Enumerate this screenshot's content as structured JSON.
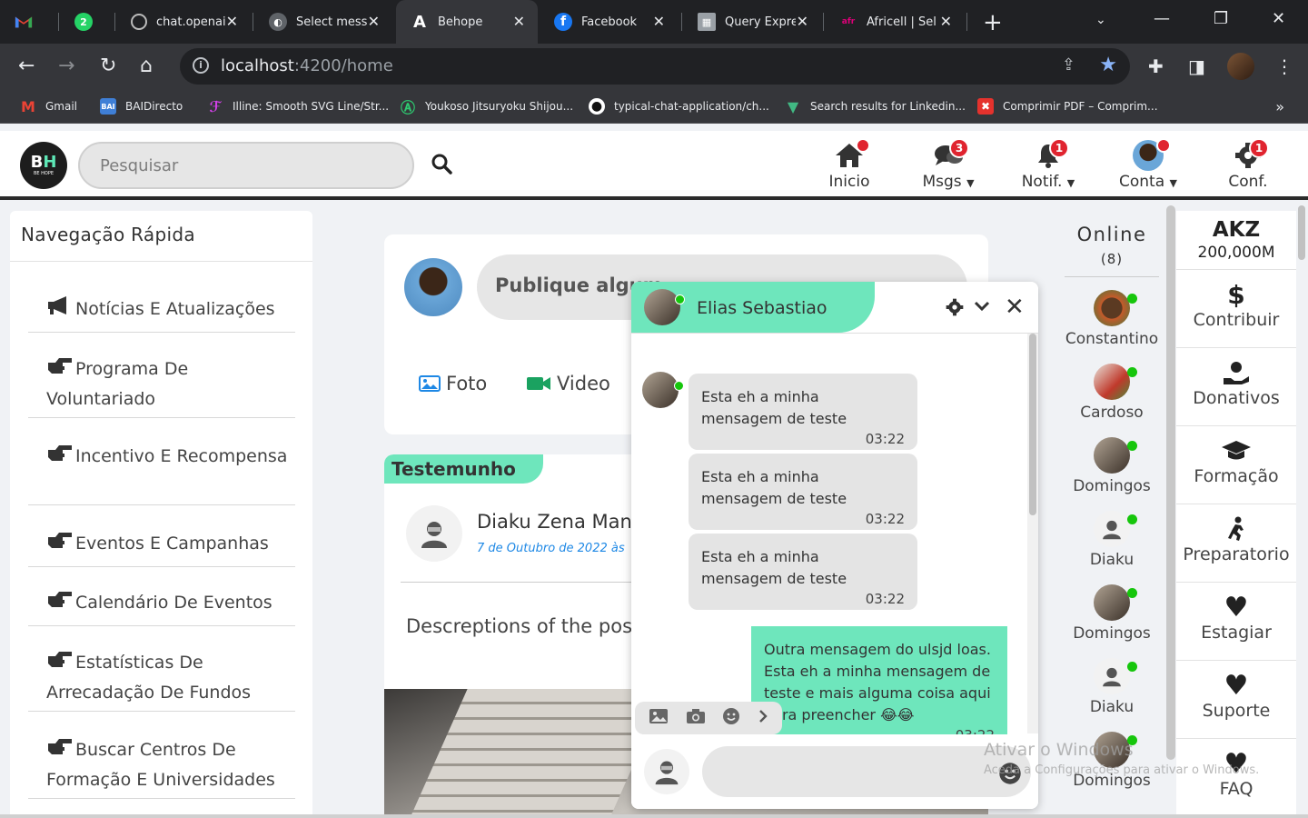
{
  "browser": {
    "tabs": [
      {
        "label": "",
        "icon": "gmail-icon"
      },
      {
        "label": "2",
        "icon": "whatsapp-icon"
      },
      {
        "label": "chat.openai.c",
        "icon": "openai-icon"
      },
      {
        "label": "Select messa",
        "icon": "globe-icon"
      },
      {
        "label": "Behope",
        "icon": "angular-icon"
      },
      {
        "label": "Facebook",
        "icon": "facebook-icon"
      },
      {
        "label": "Query Expre",
        "icon": "query-icon"
      },
      {
        "label": "Africell | Sel",
        "icon": "africell-icon"
      }
    ],
    "url_host": "localhost",
    "url_path": ":4200/home",
    "bookmarks": [
      "Gmail",
      "BAIDirecto",
      "Illine: Smooth SVG Line/Str...",
      "Youkoso Jitsuryoku Shijou...",
      "typical-chat-application/ch...",
      "Search results for Linkedin...",
      "Comprimir PDF – Comprim..."
    ],
    "baidirecto_logo": "BAI"
  },
  "header": {
    "logo_main_b": "B",
    "logo_main_h": "H",
    "logo_sub": "BE HOPE",
    "search_placeholder": "Pesquisar",
    "nav": [
      {
        "label": "Inicio",
        "badge": ""
      },
      {
        "label": "Msgs",
        "badge": "3"
      },
      {
        "label": "Notif.",
        "badge": "1"
      },
      {
        "label": "Conta",
        "badge": ""
      },
      {
        "label": "Conf.",
        "badge": "1"
      }
    ]
  },
  "sidebar": {
    "title": "Navegação Rápida",
    "items": [
      "Notícias E Atualizações",
      "Programa De Voluntariado",
      "Incentivo E Recompensa",
      "Eventos E Campanhas",
      "Calendário De Eventos",
      "Estatísticas De Arrecadação De Fundos",
      "Buscar Centros De Formação E Universidades"
    ]
  },
  "feed": {
    "publish_placeholder": "Publique algum",
    "photo_label": "Foto",
    "video_label": "Video",
    "post_tag": "Testemunho",
    "author": "Diaku Zena Manu",
    "date": "7 de Outubro de 2022 às",
    "description": "Descreptions of the post scroll nao afetar a largura"
  },
  "chat": {
    "contact": "Elias Sebastiao",
    "messages": [
      {
        "text": "Esta eh a minha mensagem de teste",
        "time": "03:22",
        "mine": false
      },
      {
        "text": "Esta eh a minha mensagem de teste",
        "time": "03:22",
        "mine": false
      },
      {
        "text": "Esta eh a minha mensagem de teste",
        "time": "03:22",
        "mine": false
      },
      {
        "text": "Outra mensagem do ulsjd loas. Esta eh a minha mensagem de teste e mais alguma coisa aqui para preencher 😂😂",
        "time": "03:22",
        "mine": true
      }
    ]
  },
  "online": {
    "title": "Online",
    "count": "(8)",
    "users": [
      "Constantino",
      "Cardoso",
      "Domingos",
      "Diaku",
      "Domingos",
      "Diaku",
      "Domingos"
    ]
  },
  "right": {
    "currency": "AKZ",
    "amount": "200,000M",
    "items": [
      "Contribuir",
      "Donativos",
      "Formação",
      "Preparatorio",
      "Estagiar",
      "Suporte",
      "FAQ"
    ]
  },
  "watermark": {
    "line1": "Ativar o Windows",
    "line2": "Aceda a Configurações para ativar o Windows."
  },
  "colors": {
    "accent_green": "#6ee6bc",
    "badge_red": "#e0242f",
    "online_green": "#16c60c",
    "link_blue": "#1e88e5"
  }
}
